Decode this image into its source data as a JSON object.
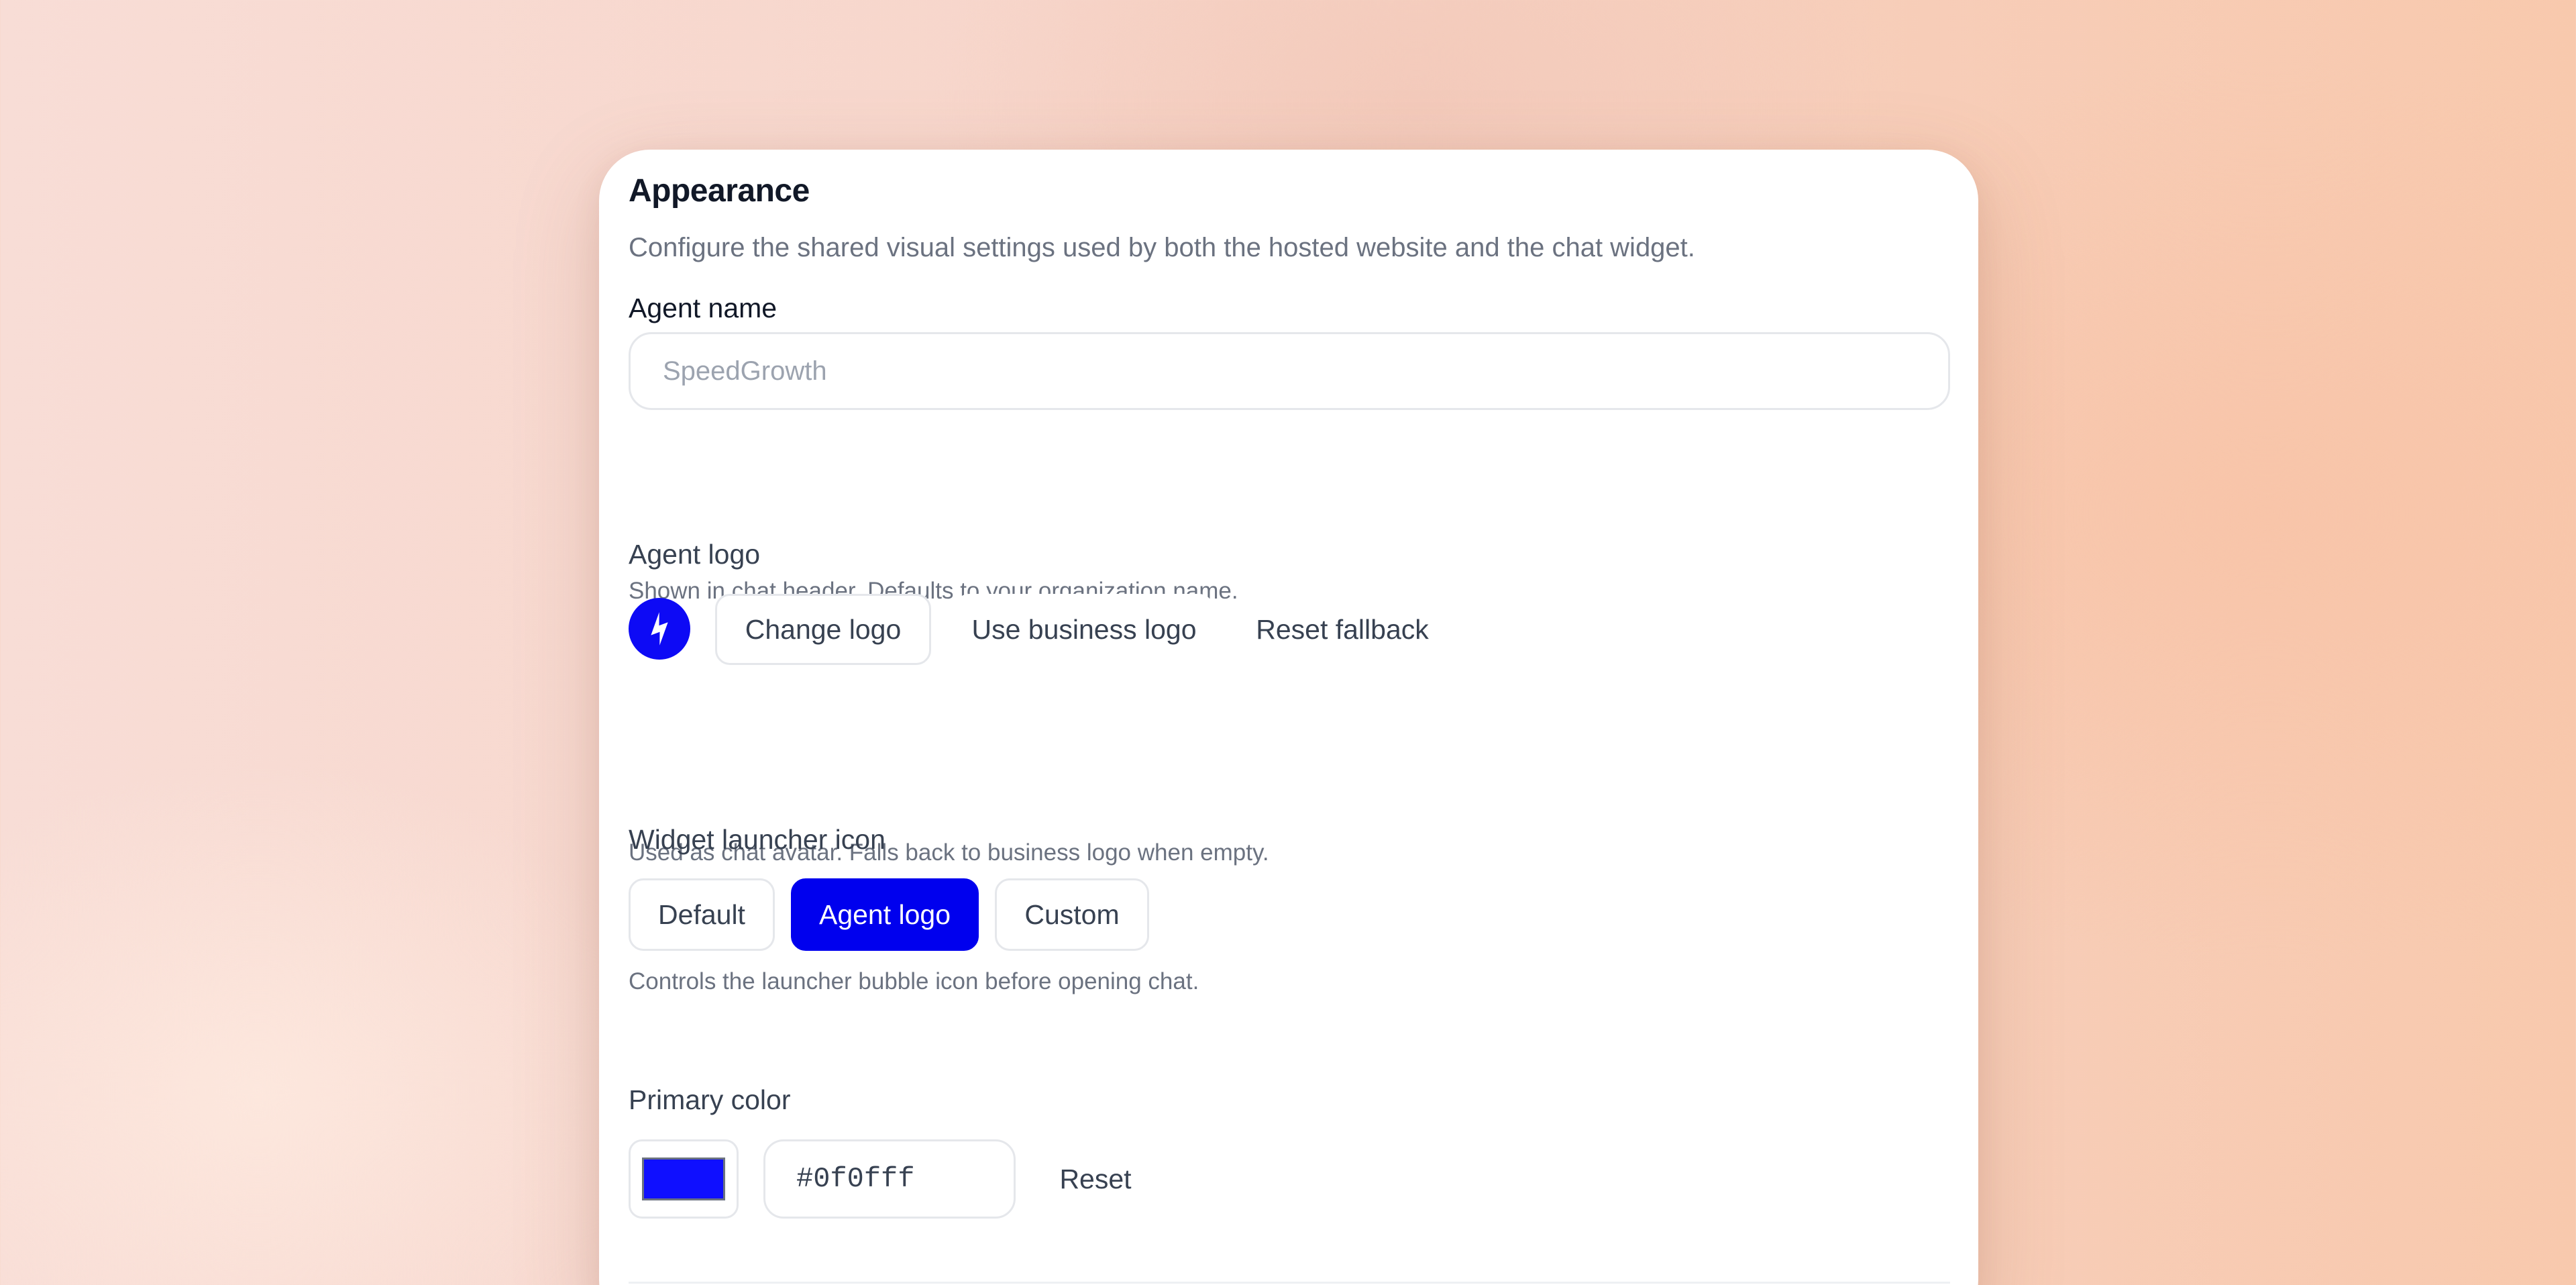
{
  "appearance": {
    "title": "Appearance",
    "subtitle": "Configure the shared visual settings used by both the hosted website and the chat widget."
  },
  "agent_name": {
    "label": "Agent name",
    "placeholder": "SpeedGrowth",
    "value": "",
    "help": "Shown in chat header. Defaults to your organization name."
  },
  "agent_logo": {
    "label": "Agent logo",
    "logo_icon": "lightning-bolt-icon",
    "change_label": "Change logo",
    "use_business_label": "Use business logo",
    "reset_label": "Reset fallback",
    "help": "Used as chat avatar. Falls back to business logo when empty."
  },
  "launcher_icon": {
    "label": "Widget launcher icon",
    "options": [
      {
        "label": "Default",
        "selected": false
      },
      {
        "label": "Agent logo",
        "selected": true
      },
      {
        "label": "Custom",
        "selected": false
      }
    ],
    "help": "Controls the launcher bubble icon before opening chat."
  },
  "primary_color": {
    "label": "Primary color",
    "value": "#0f0fff",
    "reset_label": "Reset"
  },
  "colors": {
    "accent": "#0000ee",
    "swatch": "#0f0fff"
  }
}
